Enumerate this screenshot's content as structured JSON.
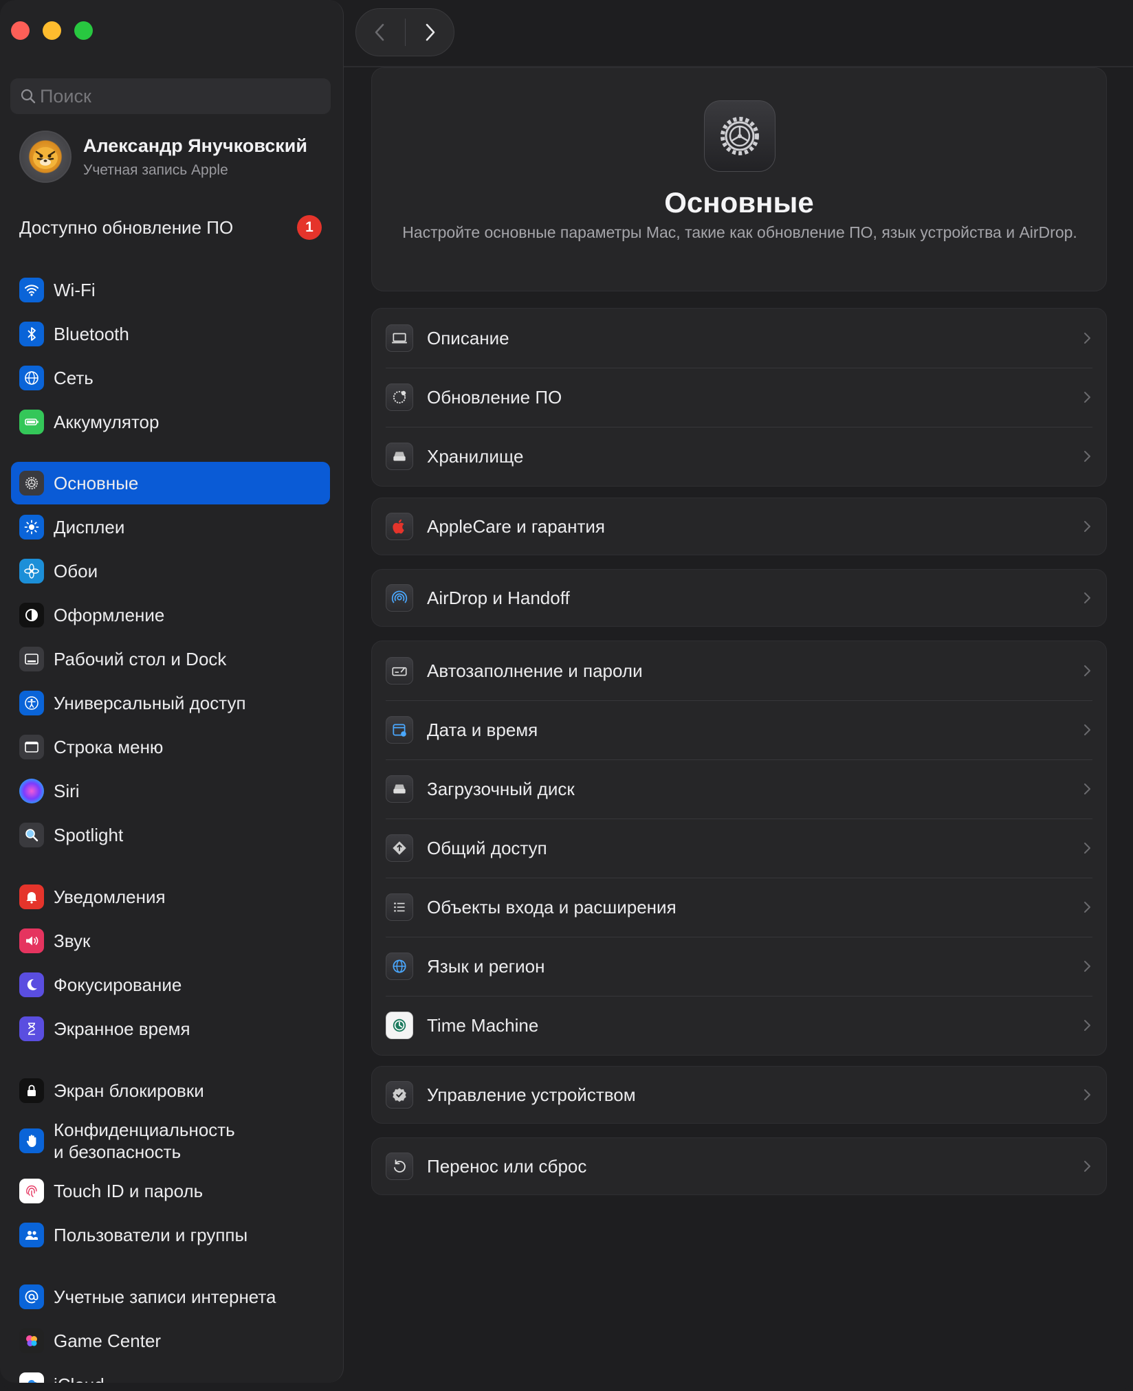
{
  "window": {
    "search_placeholder": "Поиск",
    "nav": {
      "back_icon": "chevron-left-icon",
      "forward_icon": "chevron-right-icon"
    }
  },
  "account": {
    "name": "Александр Янучковский",
    "subtitle": "Учетная запись Apple"
  },
  "update_notice": {
    "label": "Доступно обновление ПО",
    "count": "1"
  },
  "sidebar": {
    "items": [
      {
        "label": "Wi-Fi",
        "icon": "wifi-icon"
      },
      {
        "label": "Bluetooth",
        "icon": "bluetooth-icon"
      },
      {
        "label": "Сеть",
        "icon": "globe-icon"
      },
      {
        "label": "Аккумулятор",
        "icon": "battery-icon"
      },
      {
        "label": "Основные",
        "icon": "gear-icon"
      },
      {
        "label": "Дисплеи",
        "icon": "sun-icon"
      },
      {
        "label": "Обои",
        "icon": "flower-icon"
      },
      {
        "label": "Оформление",
        "icon": "appearance-icon"
      },
      {
        "label": "Рабочий стол и Dock",
        "icon": "dock-icon"
      },
      {
        "label": "Универсальный доступ",
        "icon": "accessibility-icon"
      },
      {
        "label": "Строка меню",
        "icon": "menubar-icon"
      },
      {
        "label": "Siri",
        "icon": "siri-icon"
      },
      {
        "label": "Spotlight",
        "icon": "magnifier-icon"
      },
      {
        "label": "Уведомления",
        "icon": "bell-icon"
      },
      {
        "label": "Звук",
        "icon": "speaker-icon"
      },
      {
        "label": "Фокусирование",
        "icon": "moon-icon"
      },
      {
        "label": "Экранное время",
        "icon": "hourglass-icon"
      },
      {
        "label": "Экран блокировки",
        "icon": "lock-icon"
      },
      {
        "label": "Конфиденциальность\nи безопасность",
        "icon": "hand-icon"
      },
      {
        "label": "Touch ID и пароль",
        "icon": "fingerprint-icon"
      },
      {
        "label": "Пользователи и группы",
        "icon": "users-icon"
      },
      {
        "label": "Учетные записи интернета",
        "icon": "at-icon"
      },
      {
        "label": "Game Center",
        "icon": "game-center-icon"
      },
      {
        "label": "iCloud",
        "icon": "icloud-icon"
      }
    ]
  },
  "hero": {
    "title": "Основные",
    "description": "Настройте основные параметры Mac, такие как обновление ПО, язык устройства и AirDrop."
  },
  "groups": [
    {
      "rows": [
        {
          "label": "Описание",
          "icon": "laptop-icon"
        },
        {
          "label": "Обновление ПО",
          "icon": "software-update-icon"
        },
        {
          "label": "Хранилище",
          "icon": "storage-icon"
        }
      ]
    },
    {
      "rows": [
        {
          "label": "AppleCare и гарантия",
          "icon": "apple-icon"
        }
      ]
    },
    {
      "rows": [
        {
          "label": "AirDrop и Handoff",
          "icon": "airdrop-icon"
        }
      ]
    },
    {
      "rows": [
        {
          "label": "Автозаполнение и пароли",
          "icon": "autofill-icon"
        },
        {
          "label": "Дата и время",
          "icon": "calendar-icon"
        },
        {
          "label": "Загрузочный диск",
          "icon": "disk-icon"
        },
        {
          "label": "Общий доступ",
          "icon": "sharing-icon"
        },
        {
          "label": "Объекты входа и расширения",
          "icon": "list-icon"
        },
        {
          "label": "Язык и регион",
          "icon": "globe-icon"
        },
        {
          "label": "Time Machine",
          "icon": "time-machine-icon"
        }
      ]
    },
    {
      "rows": [
        {
          "label": "Управление устройством",
          "icon": "badge-check-icon"
        }
      ]
    },
    {
      "rows": [
        {
          "label": "Перенос или сброс",
          "icon": "reset-icon"
        }
      ]
    }
  ],
  "colors": {
    "accent": "#0a5bd6",
    "badge": "#e5342b",
    "background": "#1e1e20"
  }
}
